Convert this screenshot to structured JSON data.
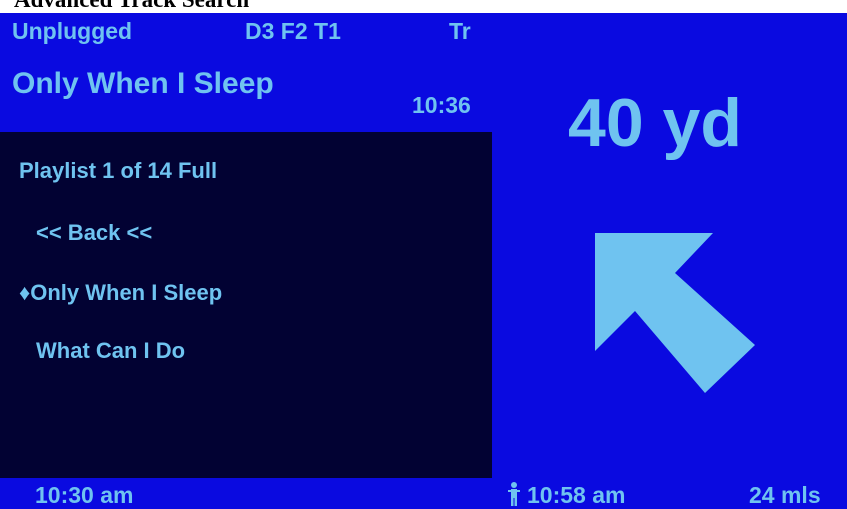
{
  "caption": "Advanced Track Search",
  "header": {
    "source": "Unplugged",
    "track_code": "D3 F2 T1",
    "mode": "Tr",
    "now_playing": "Only When I Sleep",
    "duration": "10:36"
  },
  "list": {
    "title": "Playlist 1 of 14 Full",
    "items": [
      {
        "label": "<< Back <<",
        "selected": false
      },
      {
        "label": "♦Only When I Sleep",
        "selected": true
      },
      {
        "label": "What Can I Do",
        "selected": false
      }
    ]
  },
  "navigation": {
    "distance": "40 yd",
    "direction_icon": "arrow-up-left-icon"
  },
  "status": {
    "time": "10:30 am",
    "walker_icon": "person-walking-icon",
    "arrival_time": "10:58 am",
    "remaining_distance": "24 mls"
  },
  "colors": {
    "panel_blue": "#0a0ae0",
    "list_background": "#020233",
    "text_light_blue": "#6fc3f0"
  }
}
